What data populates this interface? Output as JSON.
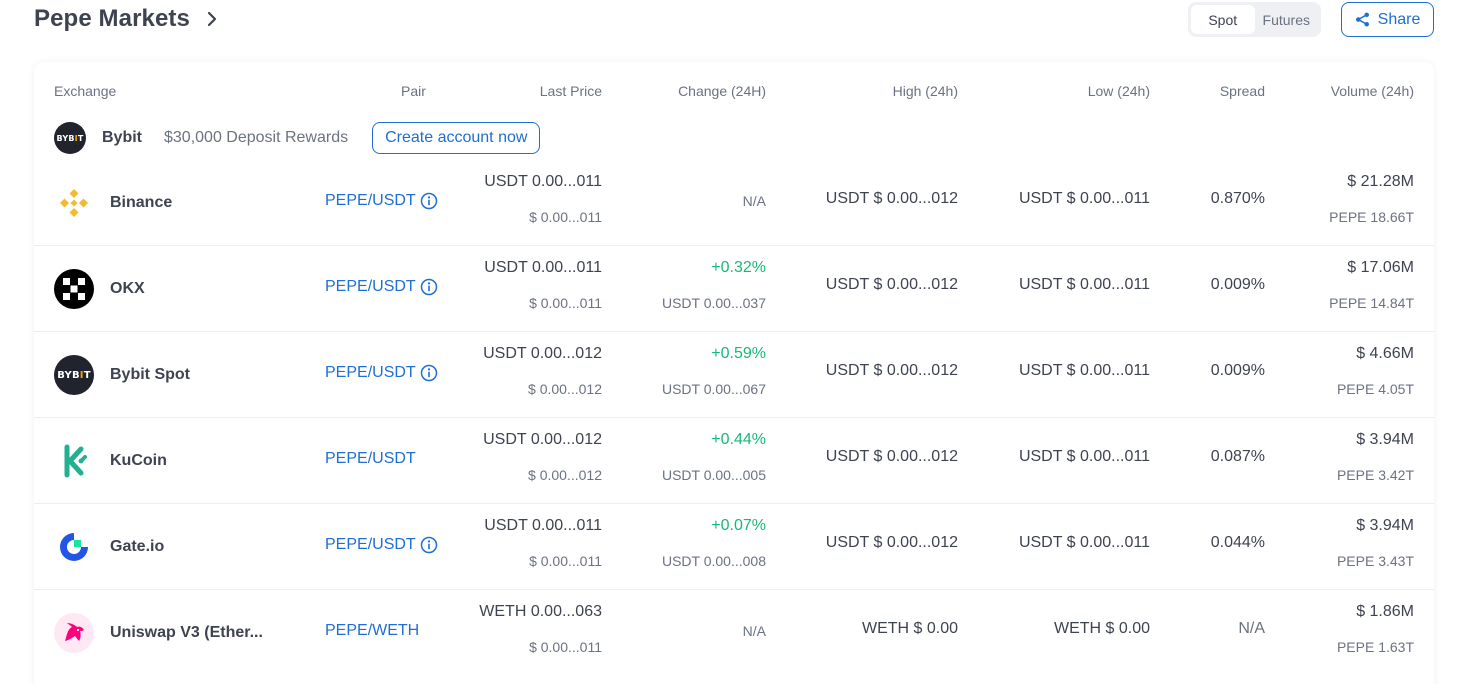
{
  "title": "Pepe Markets",
  "segment": {
    "spot": "Spot",
    "futures": "Futures",
    "active": "spot"
  },
  "share_label": "Share",
  "headers": {
    "exchange": "Exchange",
    "pair": "Pair",
    "last_price": "Last Price",
    "change": "Change (24H)",
    "high": "High (24h)",
    "low": "Low (24h)",
    "spread": "Spread",
    "volume": "Volume (24h)"
  },
  "ad": {
    "name": "Bybit",
    "promo": "$30,000 Deposit Rewards",
    "button": "Create account now",
    "logo_text": "BYBIT"
  },
  "rows": [
    {
      "exchange": "Binance",
      "logo": "binance-logo",
      "pair": "PEPE/USDT",
      "has_info": true,
      "last_price": "USDT 0.00...011",
      "last_price_usd": "$ 0.00...011",
      "change": "",
      "change_sub": "",
      "change_na": "N/A",
      "high": "USDT $ 0.00...012",
      "low": "USDT $ 0.00...011",
      "spread": "0.870%",
      "volume": "$ 21.28M",
      "volume_sub": "PEPE 18.66T"
    },
    {
      "exchange": "OKX",
      "logo": "okx-logo",
      "pair": "PEPE/USDT",
      "has_info": true,
      "last_price": "USDT 0.00...011",
      "last_price_usd": "$ 0.00...011",
      "change": "+0.32%",
      "change_sub": "USDT 0.00...037",
      "change_na": "",
      "high": "USDT $ 0.00...012",
      "low": "USDT $ 0.00...011",
      "spread": "0.009%",
      "volume": "$ 17.06M",
      "volume_sub": "PEPE 14.84T"
    },
    {
      "exchange": "Bybit Spot",
      "logo": "bybit-logo",
      "pair": "PEPE/USDT",
      "has_info": true,
      "last_price": "USDT 0.00...012",
      "last_price_usd": "$ 0.00...012",
      "change": "+0.59%",
      "change_sub": "USDT 0.00...067",
      "change_na": "",
      "high": "USDT $ 0.00...012",
      "low": "USDT $ 0.00...011",
      "spread": "0.009%",
      "volume": "$ 4.66M",
      "volume_sub": "PEPE 4.05T"
    },
    {
      "exchange": "KuCoin",
      "logo": "kucoin-logo",
      "pair": "PEPE/USDT",
      "has_info": false,
      "last_price": "USDT 0.00...012",
      "last_price_usd": "$ 0.00...012",
      "change": "+0.44%",
      "change_sub": "USDT 0.00...005",
      "change_na": "",
      "high": "USDT $ 0.00...012",
      "low": "USDT $ 0.00...011",
      "spread": "0.087%",
      "volume": "$ 3.94M",
      "volume_sub": "PEPE 3.42T"
    },
    {
      "exchange": "Gate.io",
      "logo": "gateio-logo",
      "pair": "PEPE/USDT",
      "has_info": true,
      "last_price": "USDT 0.00...011",
      "last_price_usd": "$ 0.00...011",
      "change": "+0.07%",
      "change_sub": "USDT 0.00...008",
      "change_na": "",
      "high": "USDT $ 0.00...012",
      "low": "USDT $ 0.00...011",
      "spread": "0.044%",
      "volume": "$ 3.94M",
      "volume_sub": "PEPE 3.43T"
    },
    {
      "exchange": "Uniswap V3 (Ether...",
      "logo": "uniswap-logo",
      "pair": "PEPE/WETH",
      "has_info": false,
      "last_price": "WETH 0.00...063",
      "last_price_usd": "$ 0.00...011",
      "change": "",
      "change_sub": "",
      "change_na": "N/A",
      "high": "WETH $ 0.00",
      "low": "WETH $ 0.00",
      "spread": "N/A",
      "volume": "$ 1.86M",
      "volume_sub": "PEPE 1.63T"
    }
  ],
  "colors": {
    "accent": "#1f6ed4",
    "positive": "#16b979",
    "muted": "#6b7280",
    "text": "#3e4350"
  }
}
